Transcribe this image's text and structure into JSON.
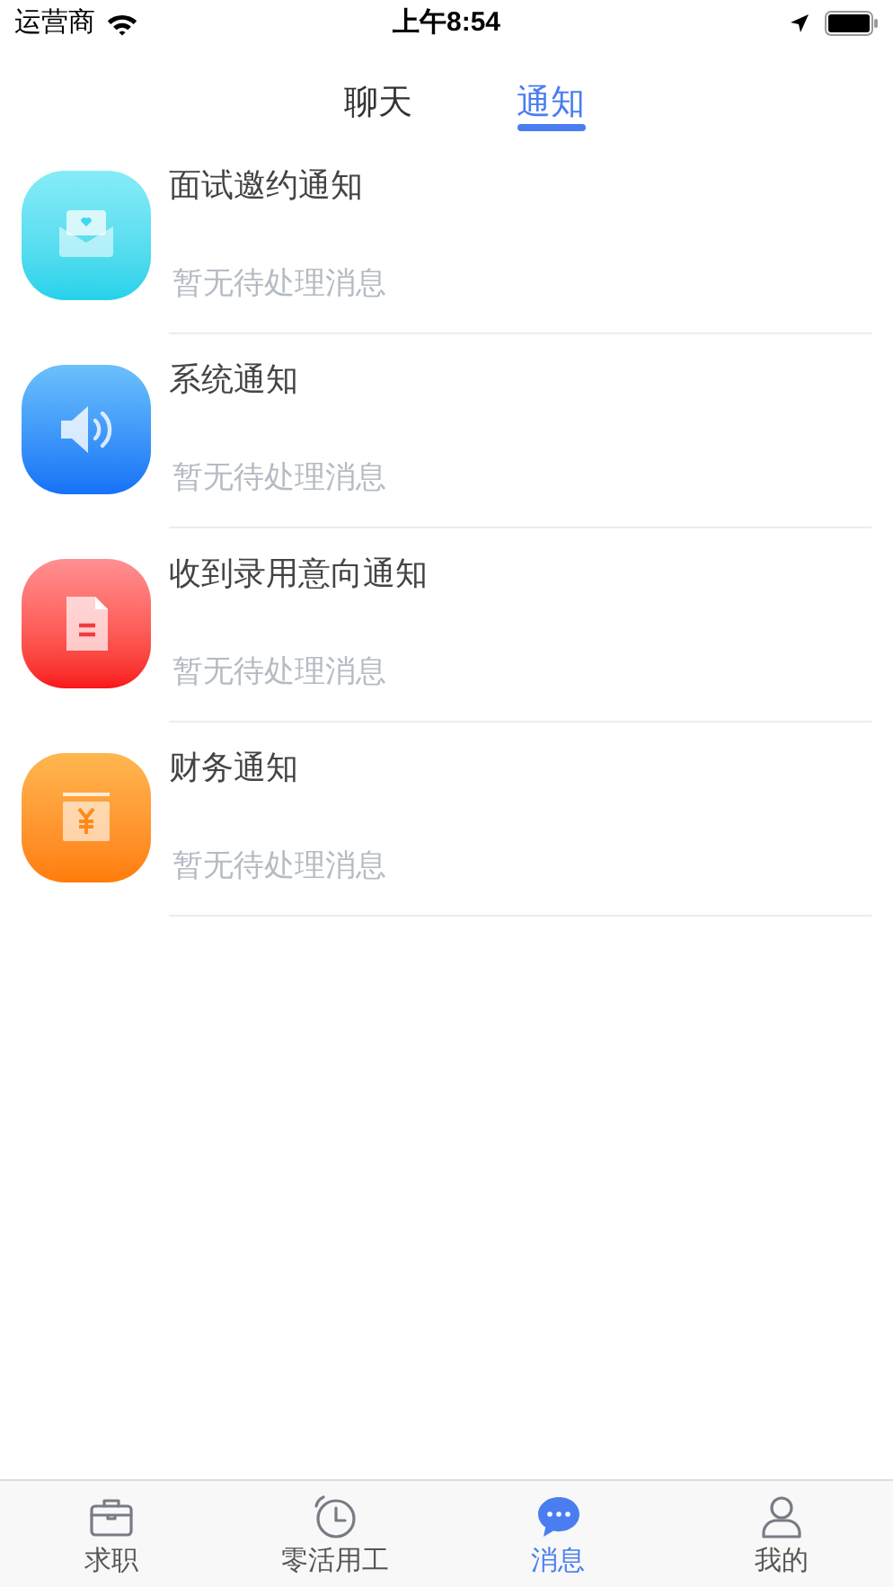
{
  "status_bar": {
    "carrier": "运营商",
    "time": "上午8:54"
  },
  "tabs": [
    {
      "label": "聊天",
      "selected": false
    },
    {
      "label": "通知",
      "selected": true
    }
  ],
  "notifications": [
    {
      "kind": "invite",
      "title": "面试邀约通知",
      "subtitle": "暂无待处理消息"
    },
    {
      "kind": "system",
      "title": "系统通知",
      "subtitle": "暂无待处理消息"
    },
    {
      "kind": "offer",
      "title": "收到录用意向通知",
      "subtitle": "暂无待处理消息"
    },
    {
      "kind": "finance",
      "title": "财务通知",
      "subtitle": "暂无待处理消息"
    }
  ],
  "bottom_nav": [
    {
      "kind": "jobs",
      "label": "求职",
      "selected": false
    },
    {
      "kind": "gig",
      "label": "零活用工",
      "selected": false
    },
    {
      "kind": "messages",
      "label": "消息",
      "selected": true
    },
    {
      "kind": "me",
      "label": "我的",
      "selected": false
    }
  ]
}
